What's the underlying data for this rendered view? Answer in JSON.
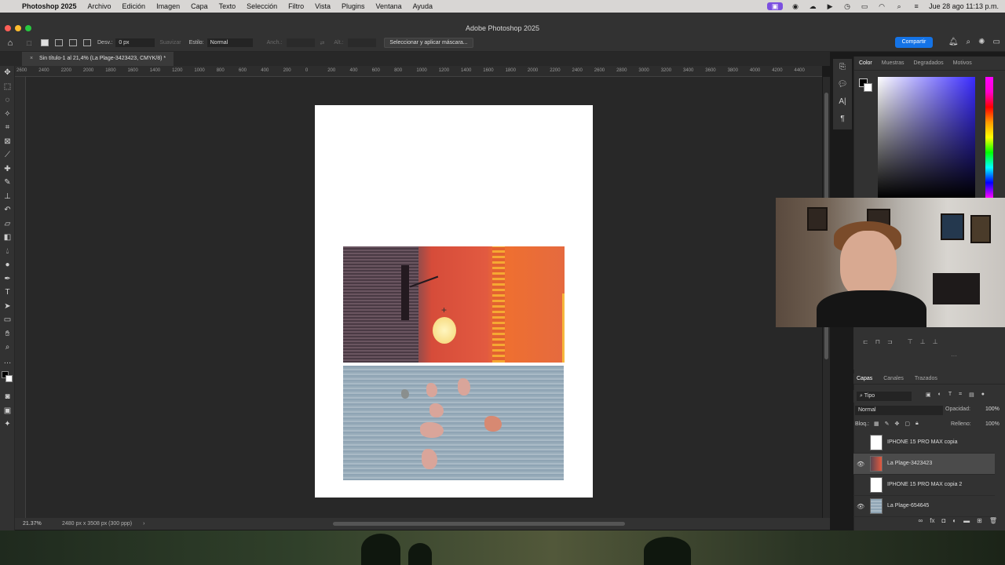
{
  "menubar": {
    "app": "Photoshop 2025",
    "items": [
      "Archivo",
      "Edición",
      "Imagen",
      "Capa",
      "Texto",
      "Selección",
      "Filtro",
      "Vista",
      "Plugins",
      "Ventana",
      "Ayuda"
    ],
    "clock": "Jue 28 ago 11:13 p.m."
  },
  "window": {
    "title": "Adobe Photoshop 2025"
  },
  "options": {
    "feather_label": "Desv.:",
    "feather_value": "0 px",
    "smooth_label": "Suavizar",
    "style_label": "Estilo:",
    "style_value": "Normal",
    "width_label": "Anch.:",
    "height_label": "Alt.:",
    "mask_button": "Seleccionar y aplicar máscara...",
    "share_button": "Compartir"
  },
  "document": {
    "tab_title": "Sin título-1 al 21,4% (La Plage-3423423, CMYK/8) *",
    "zoom": "21.37%",
    "info": "2480 px x 3508 px (300 ppp)"
  },
  "ruler_h": {
    "labels": [
      "2600",
      "2400",
      "2200",
      "2000",
      "1800",
      "1600",
      "1400",
      "1200",
      "1000",
      "800",
      "600",
      "400",
      "200",
      "0",
      "200",
      "400",
      "600",
      "800",
      "1000",
      "1200",
      "1400",
      "1600",
      "1800",
      "2000",
      "2200",
      "2400",
      "2600",
      "2800",
      "3000",
      "3200",
      "3400",
      "3600",
      "3800",
      "4000",
      "4200",
      "4400"
    ]
  },
  "color_panel": {
    "tabs": [
      "Color",
      "Muestras",
      "Degradados",
      "Motivos"
    ],
    "active": "Color",
    "foreground": "#000000",
    "background": "#ffffff"
  },
  "layers_panel": {
    "tabs": [
      "Capas",
      "Canales",
      "Trazados"
    ],
    "active": "Capas",
    "kind_filter": "Tipo",
    "blend_mode": "Normal",
    "opacity_label": "Opacidad:",
    "opacity_value": "100%",
    "lock_label": "Bloq.:",
    "fill_label": "Relleno:",
    "fill_value": "100%",
    "layers": [
      {
        "name": "IPHONE 15 PRO MAX copia",
        "visible": false,
        "selected": false
      },
      {
        "name": "La Plage-3423423",
        "visible": true,
        "selected": true
      },
      {
        "name": "IPHONE 15 PRO MAX copia 2",
        "visible": false,
        "selected": false
      },
      {
        "name": "La Plage-654645",
        "visible": true,
        "selected": false
      }
    ]
  },
  "colors": {
    "accent": "#1473e6",
    "panel_bg": "#323232",
    "canvas_bg": "#282828"
  }
}
